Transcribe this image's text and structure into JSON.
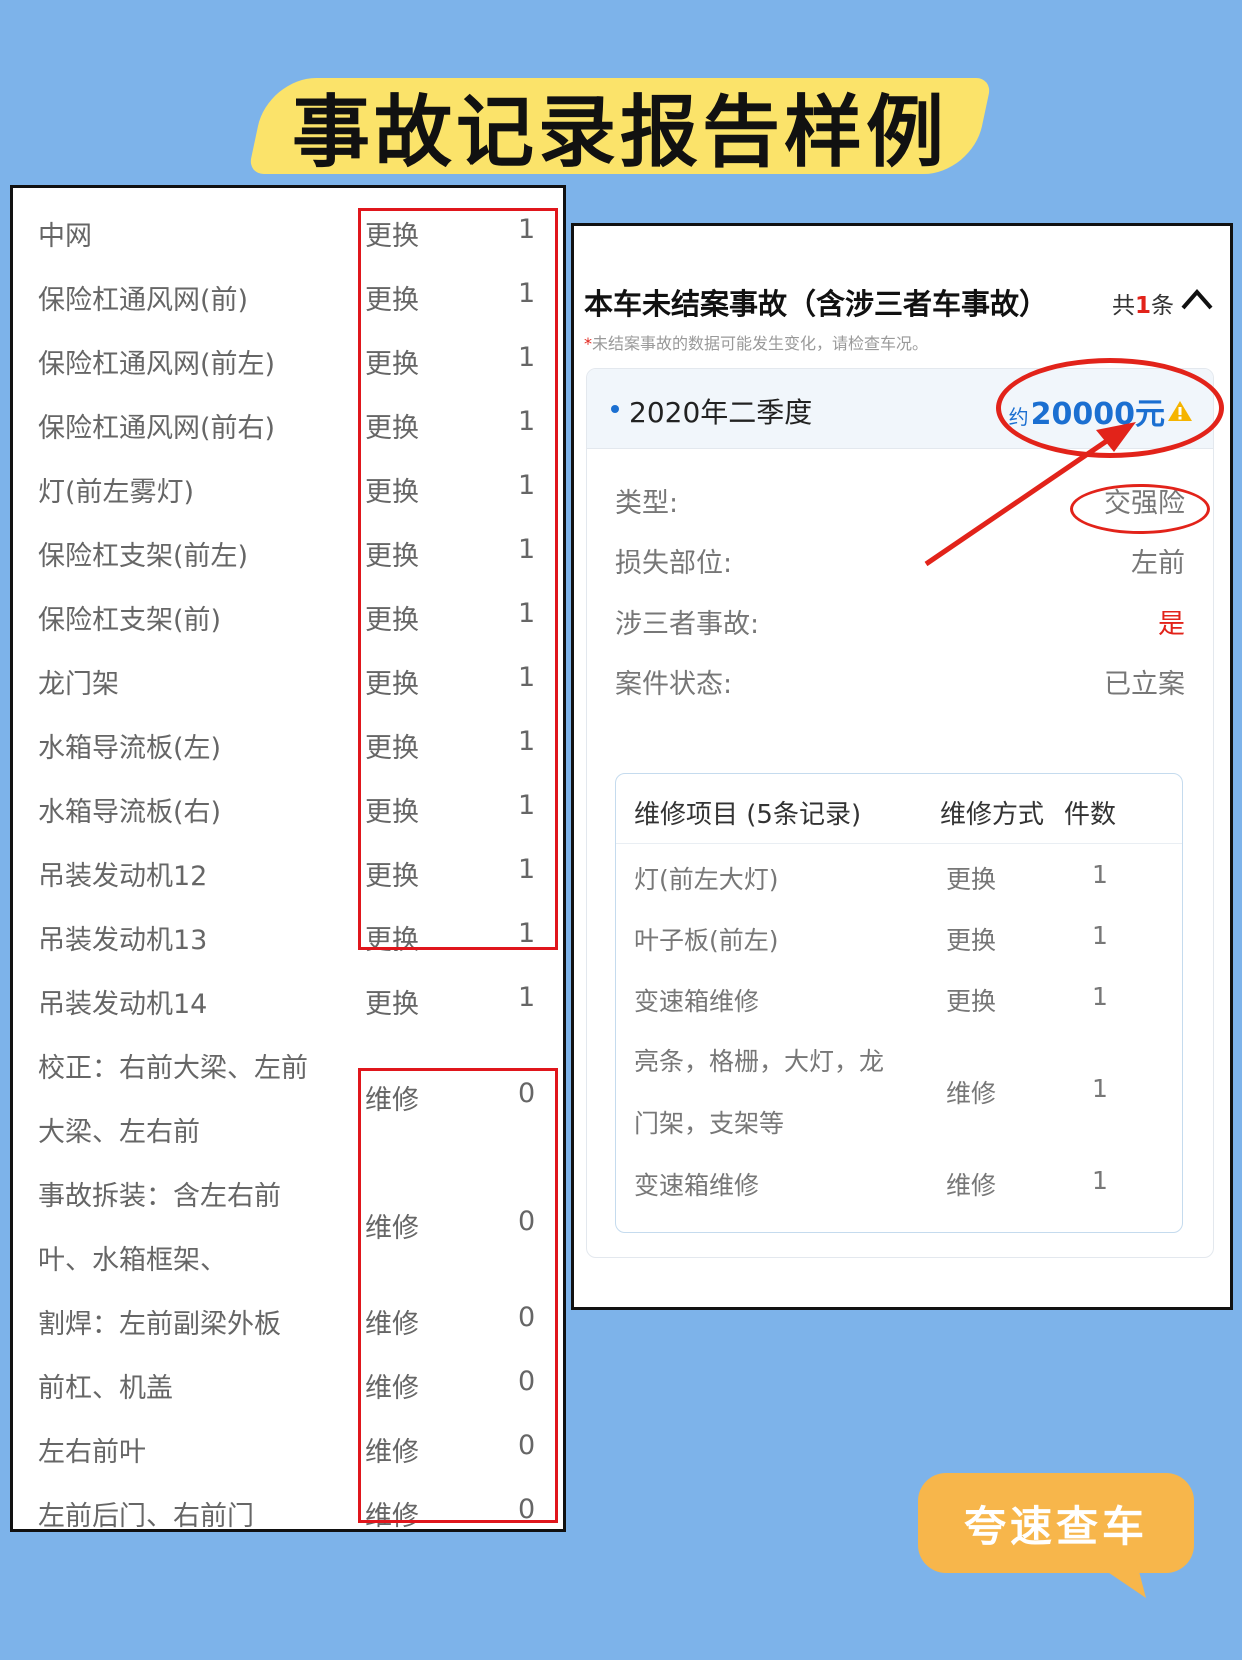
{
  "banner": {
    "title": "事故记录报告样例"
  },
  "left_table": {
    "rows": [
      {
        "name": "中网",
        "method": "更换",
        "qty": "1"
      },
      {
        "name": "保险杠通风网(前)",
        "method": "更换",
        "qty": "1"
      },
      {
        "name": "保险杠通风网(前左)",
        "method": "更换",
        "qty": "1"
      },
      {
        "name": "保险杠通风网(前右)",
        "method": "更换",
        "qty": "1"
      },
      {
        "name": "灯(前左雾灯)",
        "method": "更换",
        "qty": "1"
      },
      {
        "name": "保险杠支架(前左)",
        "method": "更换",
        "qty": "1"
      },
      {
        "name": "保险杠支架(前)",
        "method": "更换",
        "qty": "1"
      },
      {
        "name": "龙门架",
        "method": "更换",
        "qty": "1"
      },
      {
        "name": "水箱导流板(左)",
        "method": "更换",
        "qty": "1"
      },
      {
        "name": "水箱导流板(右)",
        "method": "更换",
        "qty": "1"
      },
      {
        "name": "吊装发动机12",
        "method": "更换",
        "qty": "1"
      },
      {
        "name": "吊装发动机13",
        "method": "更换",
        "qty": "1"
      },
      {
        "name": "吊装发动机14",
        "method": "更换",
        "qty": "1"
      },
      {
        "name_lines": [
          "校正：右前大梁、左前",
          "大梁、左右前"
        ],
        "method": "维修",
        "qty": "0"
      },
      {
        "name_lines": [
          "事故拆装：含左右前",
          "叶、水箱框架、"
        ],
        "method": "维修",
        "qty": "0"
      },
      {
        "name": "割焊：左前副梁外板",
        "method": "维修",
        "qty": "0"
      },
      {
        "name": "前杠、机盖",
        "method": "维修",
        "qty": "0"
      },
      {
        "name": "左右前叶",
        "method": "维修",
        "qty": "0"
      },
      {
        "name": "左前后门、右前门",
        "method": "维修",
        "qty": "0"
      }
    ]
  },
  "report": {
    "title": "本车未结案事故（含涉三者车事故）",
    "count_prefix": "共",
    "count": "1",
    "count_suffix": "条",
    "note_star": "*",
    "note": "未结案事故的数据可能发生变化，请检查车况。",
    "period": "2020年二季度",
    "amount_prefix": "约",
    "amount": "20000元",
    "fields": [
      {
        "label": "类型:",
        "value": "交强险",
        "highlight": false
      },
      {
        "label": "损失部位:",
        "value": "左前",
        "highlight": false
      },
      {
        "label": "涉三者事故:",
        "value": "是",
        "highlight": true
      },
      {
        "label": "案件状态:",
        "value": "已立案",
        "highlight": false
      }
    ],
    "repair_table": {
      "headers": [
        "维修项目 (5条记录)",
        "维修方式",
        "件数"
      ],
      "rows": [
        {
          "item": "灯(前左大灯)",
          "method": "更换",
          "qty": "1"
        },
        {
          "item": "叶子板(前左)",
          "method": "更换",
          "qty": "1"
        },
        {
          "item": "变速箱维修",
          "method": "更换",
          "qty": "1"
        },
        {
          "item_lines": [
            "亮条，格栅，大灯，龙",
            "门架，支架等"
          ],
          "method": "维修",
          "qty": "1"
        },
        {
          "item": "变速箱维修",
          "method": "维修",
          "qty": "1"
        }
      ]
    }
  },
  "bubble": {
    "label": "夸速查车"
  },
  "colors": {
    "background": "#7db3ea",
    "banner": "#fbe36a",
    "accent_red": "#e2231a",
    "blue": "#1b6fd1",
    "bubble": "#f7b64b"
  }
}
